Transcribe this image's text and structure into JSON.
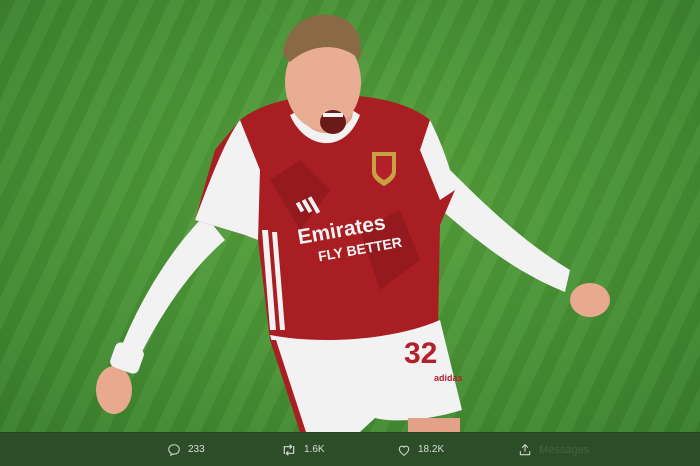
{
  "tweet_actions": {
    "reply": {
      "icon": "reply-icon",
      "count": "233"
    },
    "retweet": {
      "icon": "retweet-icon",
      "count": "1.6K"
    },
    "like": {
      "icon": "heart-icon",
      "count": "18.2K"
    },
    "share": {
      "icon": "share-icon",
      "label": "Messages"
    }
  },
  "photo": {
    "jersey_sponsor_line1": "Emirates",
    "jersey_sponsor_line2": "FLY BETTER",
    "shorts_number": "32",
    "shorts_brand": "adidas",
    "colors": {
      "pitch": "#4b9637",
      "shirt": "#a91e22",
      "sleeve": "#f2f2f2",
      "action_bar": "#2c4d28"
    }
  }
}
